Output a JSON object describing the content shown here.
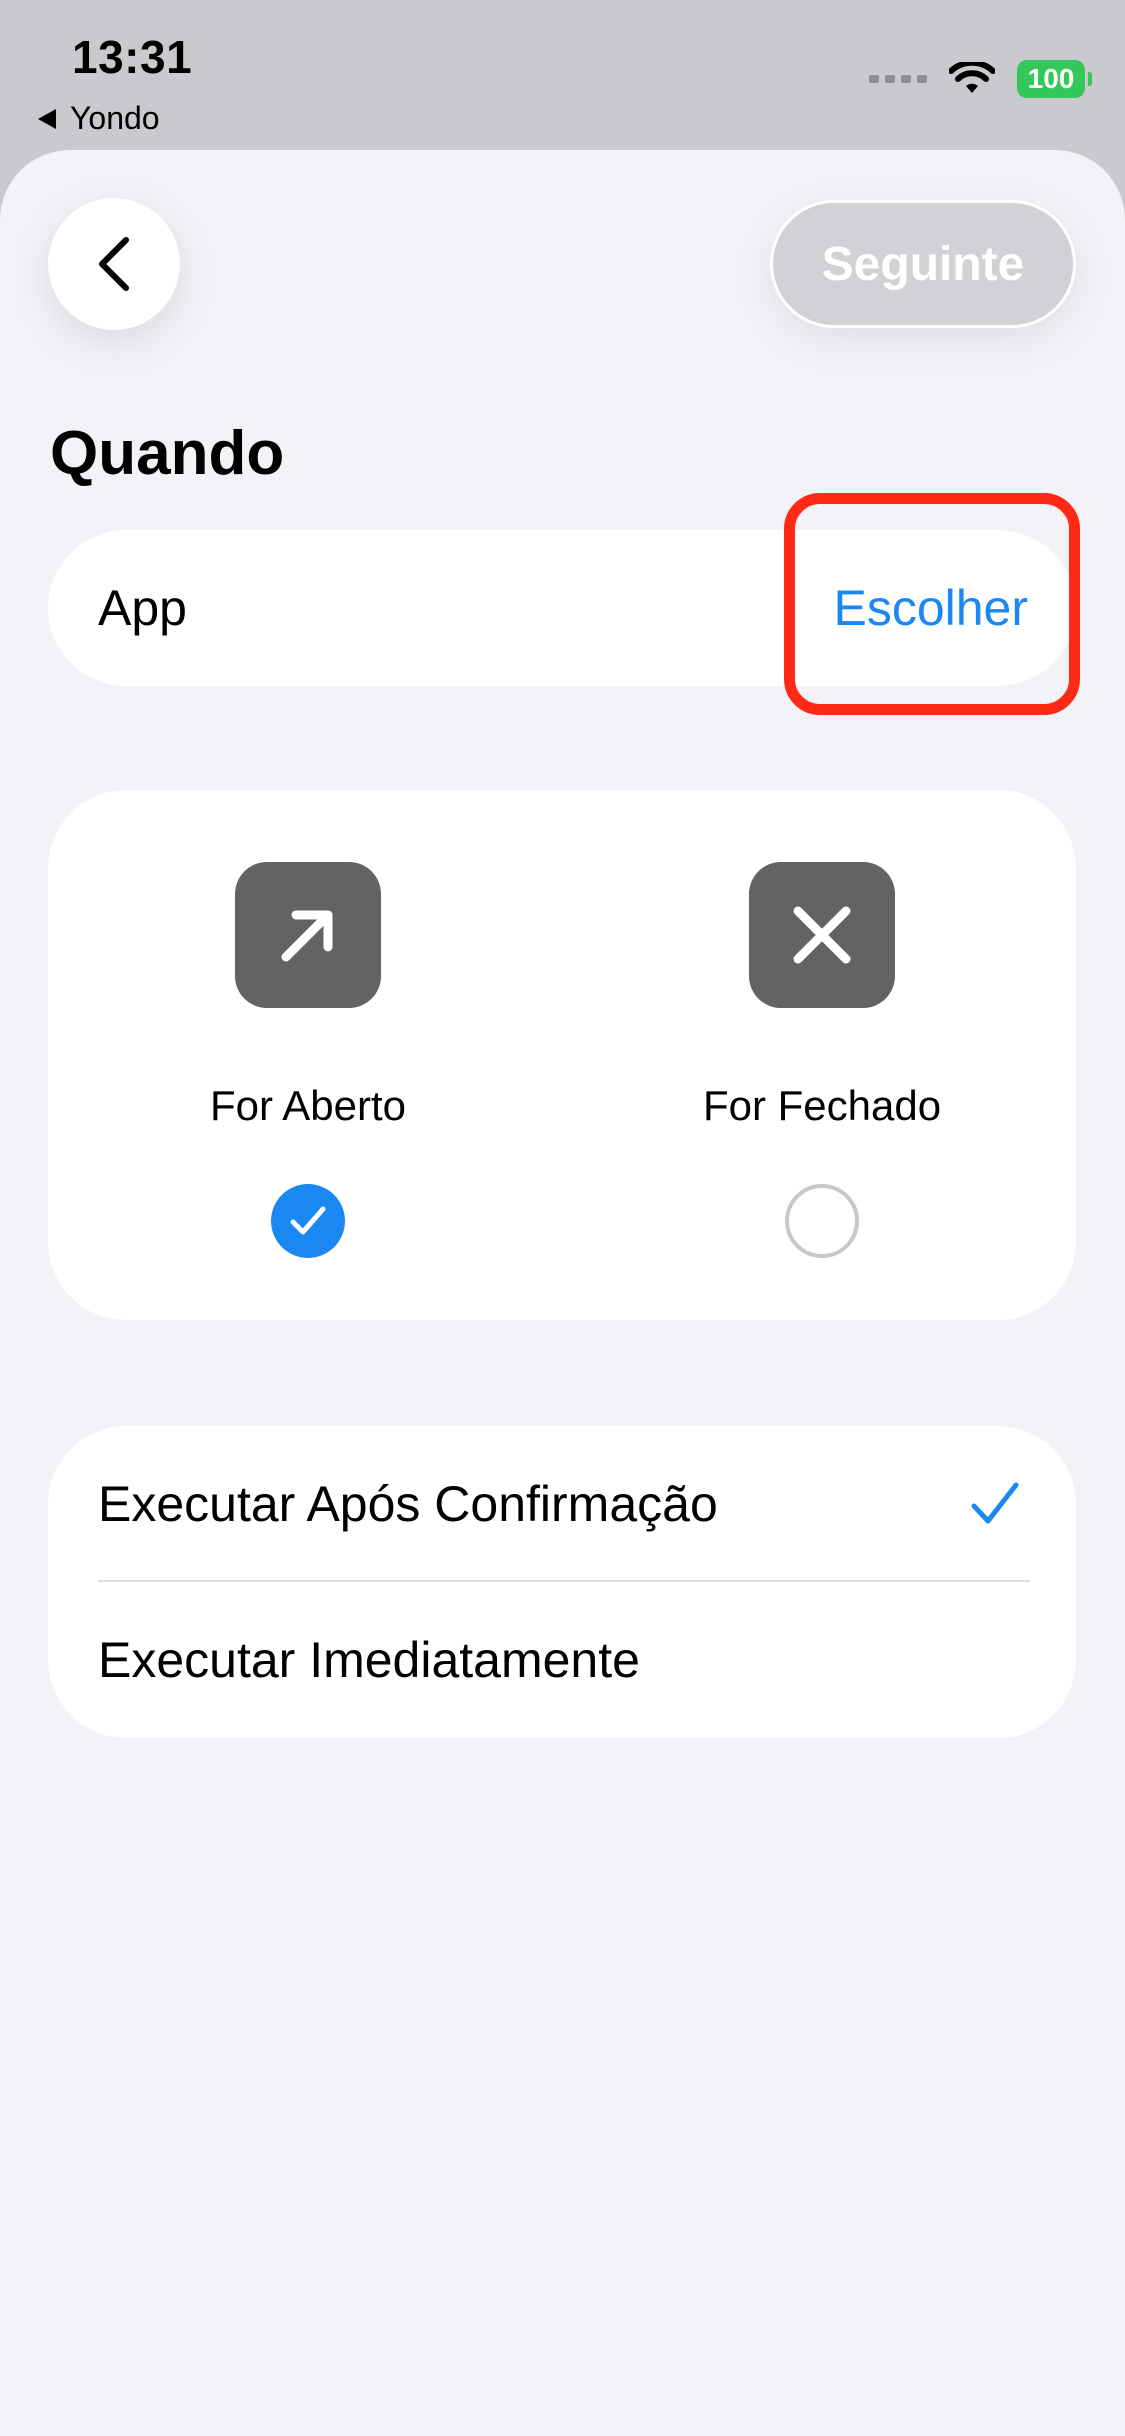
{
  "status_bar": {
    "time": "13:31",
    "back_app": "Yondo",
    "battery": "100",
    "battery_color": "#34c759"
  },
  "header": {
    "back_icon": "chevron-left-icon",
    "next_label": "Seguinte"
  },
  "section": {
    "title": "Quando"
  },
  "app_row": {
    "label": "App",
    "action_label": "Escolher",
    "action_color": "#1a87f2",
    "highlight_color": "#ff2a16"
  },
  "state_options": [
    {
      "label": "For Aberto",
      "icon": "arrow-up-right-icon",
      "selected": true
    },
    {
      "label": "For Fechado",
      "icon": "x-mark-icon",
      "selected": false
    }
  ],
  "execution_options": [
    {
      "label": "Executar Após Confirmação",
      "selected": true
    },
    {
      "label": "Executar Imediatamente",
      "selected": false
    }
  ]
}
